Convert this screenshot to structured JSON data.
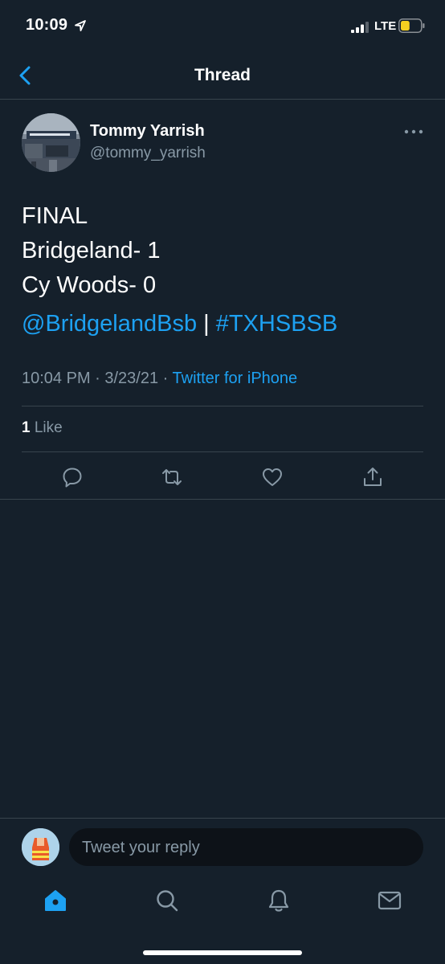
{
  "status_bar": {
    "time": "10:09",
    "network": "LTE",
    "battery_level": 0.45,
    "battery_color": "#f5d020"
  },
  "nav": {
    "title": "Thread"
  },
  "tweet": {
    "author_name": "Tommy Yarrish",
    "author_handle": "@tommy_yarrish",
    "lines": [
      "FINAL",
      "Bridgeland- 1",
      "Cy Woods- 0"
    ],
    "mention": "@BridgelandBsb",
    "separator": "|",
    "hashtag": "#TXHSBSB",
    "timestamp": "10:04 PM · 3/23/21 · ",
    "source": "Twitter for iPhone",
    "like_count": "1",
    "like_label": "Like"
  },
  "reply": {
    "placeholder": "Tweet your reply"
  },
  "tabs": [
    "home-icon",
    "search-icon",
    "notifications-icon",
    "messages-icon"
  ],
  "colors": {
    "background": "#15202b",
    "accent": "#1da1f2",
    "secondary_text": "#8899a6",
    "divider": "#38444d"
  }
}
